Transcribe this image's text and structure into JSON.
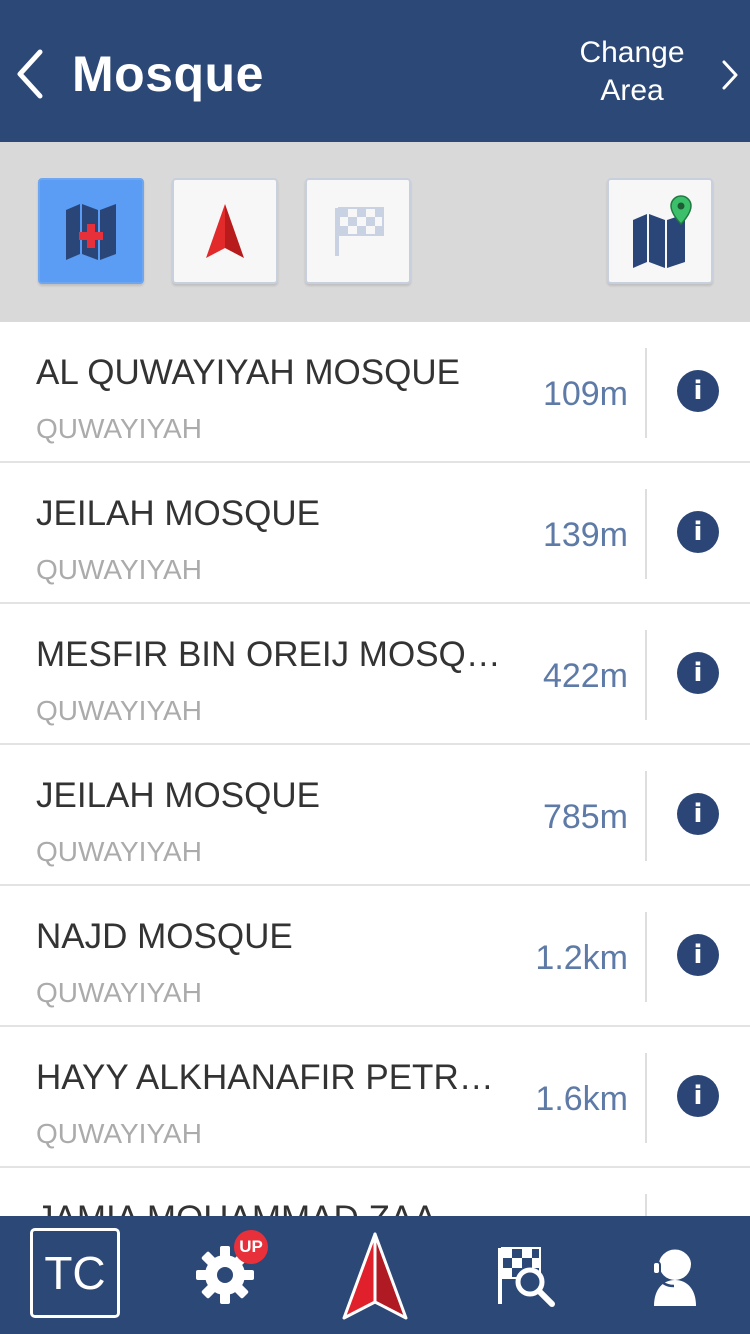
{
  "header": {
    "title": "Mosque",
    "change_area_line1": "Change",
    "change_area_line2": "Area"
  },
  "toolbar": {
    "buttons": [
      {
        "icon": "map-plus-icon",
        "active": true
      },
      {
        "icon": "navigation-arrow-icon",
        "active": false
      },
      {
        "icon": "checkered-flag-icon",
        "active": false
      },
      {
        "icon": "map-pin-icon",
        "active": false
      }
    ]
  },
  "places": [
    {
      "name": "AL QUWAYIYAH MOSQUE",
      "area": "QUWAYIYAH",
      "distance": "109m"
    },
    {
      "name": "JEILAH MOSQUE",
      "area": "QUWAYIYAH",
      "distance": "139m"
    },
    {
      "name": "MESFIR BIN OREIJ MOSQ…",
      "area": "QUWAYIYAH",
      "distance": "422m"
    },
    {
      "name": "JEILAH MOSQUE",
      "area": "QUWAYIYAH",
      "distance": "785m"
    },
    {
      "name": "NAJD MOSQUE",
      "area": "QUWAYIYAH",
      "distance": "1.2km"
    },
    {
      "name": "HAYY ALKHANAFIR PETR…",
      "area": "QUWAYIYAH",
      "distance": "1.6km"
    },
    {
      "name": "JAMIA MOHAMMAD ZAA…",
      "area": "",
      "distance": ""
    }
  ],
  "info_label": "i",
  "bottom_nav": {
    "tc_label": "TC",
    "settings_badge": "UP",
    "items": [
      "tc-icon",
      "settings-icon",
      "navigation-arrow-icon",
      "search-flag-icon",
      "support-agent-icon"
    ]
  },
  "colors": {
    "header_bg": "#2c4877",
    "toolbar_bg": "#d9d9d9",
    "active_button": "#5b9cf4",
    "distance_text": "#5e7aa7",
    "badge_red": "#e8303a",
    "arrow_red": "#e0202a"
  }
}
